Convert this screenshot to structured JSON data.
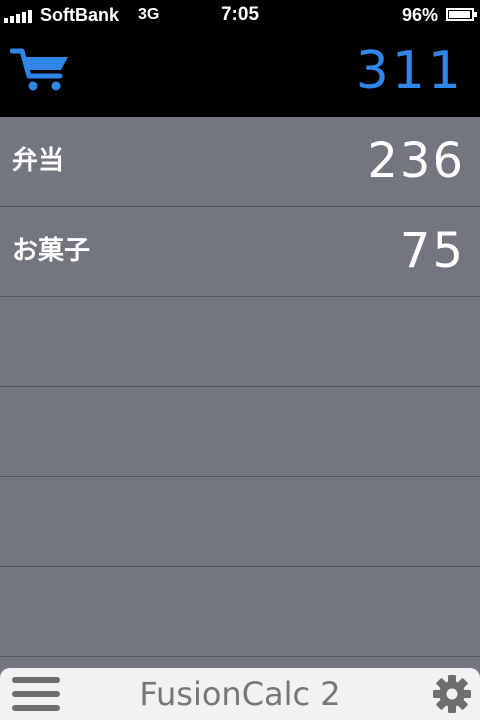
{
  "status_bar": {
    "carrier": "SoftBank",
    "network": "3G",
    "time": "7:05",
    "battery_percent_label": "96%",
    "battery_level": 0.96,
    "signal_bars": 5
  },
  "header": {
    "cart_icon": "shopping-cart-icon",
    "total": "311",
    "accent_color": "#2f86e6"
  },
  "items": [
    {
      "label": "弁当",
      "value": "236"
    },
    {
      "label": "お菓子",
      "value": "75"
    },
    {
      "label": "",
      "value": ""
    },
    {
      "label": "",
      "value": ""
    },
    {
      "label": "",
      "value": ""
    },
    {
      "label": "",
      "value": ""
    }
  ],
  "footer": {
    "menu_icon": "hamburger-menu-icon",
    "app_title": "FusionCalc 2",
    "settings_icon": "gear-icon"
  },
  "colors": {
    "list_background": "#73757f",
    "header_background": "#000000",
    "footer_background": "#f2f2f2"
  }
}
